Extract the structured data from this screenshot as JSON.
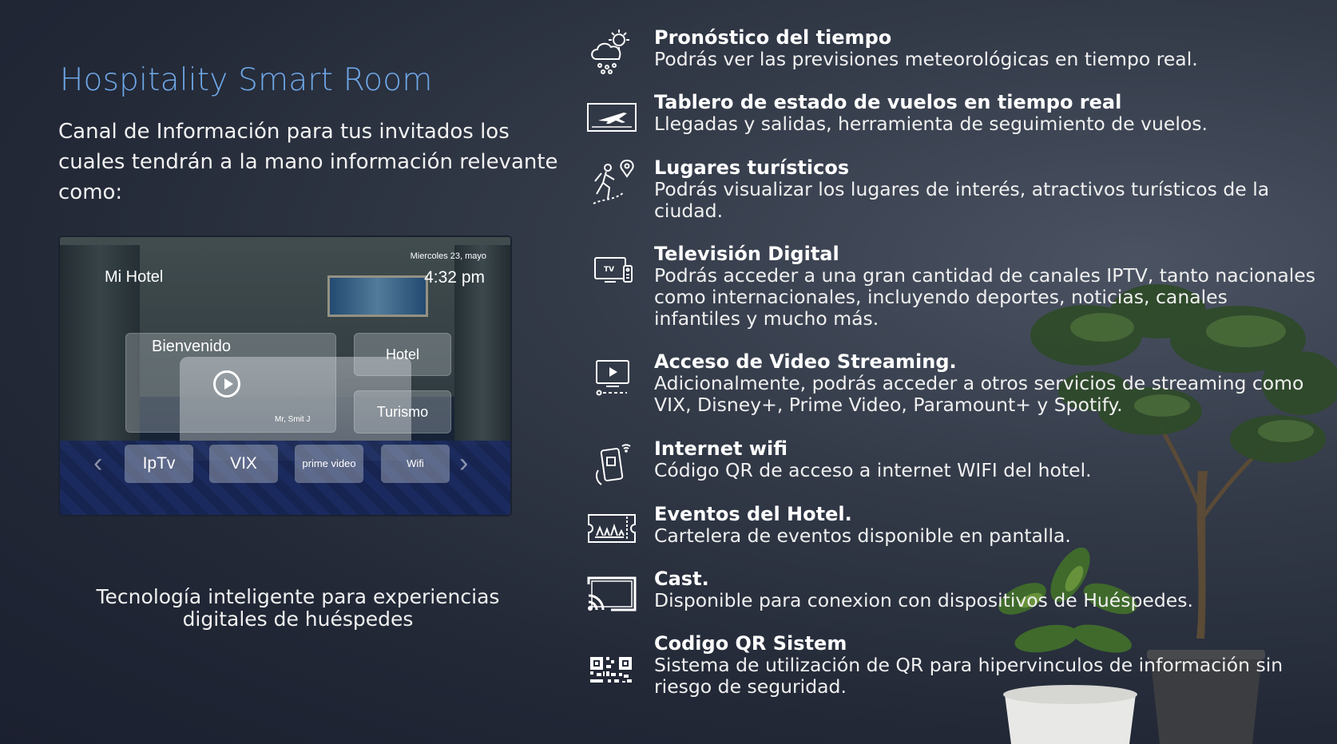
{
  "title": "Hospitality Smart Room",
  "intro": "Canal de Información para tus invitados los cuales tendrán a la mano información relevante como:",
  "tagline": "Tecnología inteligente para experiencias digitales de huéspedes",
  "tv": {
    "date": "Miercoles 23, mayo",
    "hotel_name": "Mi Hotel",
    "time": "4:32 pm",
    "welcome": "Bienvenido",
    "guest": "Mr, Smit J",
    "hotel_btn": "Hotel",
    "tour_btn": "Turismo",
    "apps": [
      "IpTv",
      "VIX",
      "prime  video",
      "Wifi"
    ]
  },
  "features": [
    {
      "icon": "weather-icon",
      "title": "Pronóstico del tiempo",
      "desc": "Podrás ver las previsiones meteorológicas en tiempo real."
    },
    {
      "icon": "flight-board-icon",
      "title": "Tablero de estado de vuelos en tiempo real",
      "desc": "Llegadas y salidas, herramienta de seguimiento de vuelos."
    },
    {
      "icon": "hiker-location-icon",
      "title": "Lugares turísticos",
      "desc": "Podrás visualizar los lugares de interés, atractivos turísticos de la ciudad."
    },
    {
      "icon": "tv-icon",
      "title": "Televisión Digital",
      "desc": "Podrás acceder a una gran cantidad de canales IPTV, tanto nacionales como internacionales, incluyendo deportes, noticias, canales infantiles y mucho más."
    },
    {
      "icon": "video-streaming-icon",
      "title": "Acceso de Video Streaming.",
      "desc": "Adicionalmente, podrás acceder a otros servicios de streaming como VIX, Disney+, Prime Video, Paramount+ y Spotify."
    },
    {
      "icon": "phone-wifi-qr-icon",
      "title": "Internet wifi",
      "desc": "Código QR de acceso a internet WIFI del hotel."
    },
    {
      "icon": "event-ticket-icon",
      "title": "Eventos del Hotel.",
      "desc": "Cartelera de eventos disponible en pantalla."
    },
    {
      "icon": "cast-icon",
      "title": "Cast.",
      "desc": "Disponible para conexion con dispositivos de Huéspedes."
    },
    {
      "icon": "qr-code-icon",
      "title": "Codigo QR Sistem",
      "desc": "Sistema de utilización de QR para hipervinculos de información sin riesgo de seguridad."
    }
  ]
}
